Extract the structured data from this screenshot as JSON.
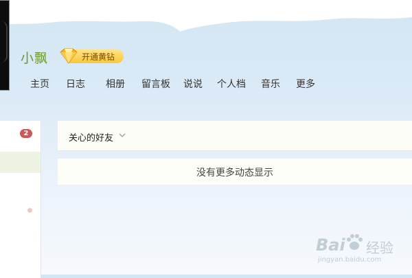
{
  "profile": {
    "username": "小飘",
    "vip_label": "开通黄钻",
    "icon": "diamond-icon"
  },
  "nav": {
    "items": [
      {
        "label": "主页"
      },
      {
        "label": "日志"
      },
      {
        "label": "相册"
      },
      {
        "label": "留言板"
      },
      {
        "label": "说说"
      },
      {
        "label": "个人档"
      },
      {
        "label": "音乐"
      },
      {
        "label": "更多"
      }
    ]
  },
  "sidebar": {
    "badge_count": "2"
  },
  "feed": {
    "filter_label": "关心的好友",
    "filter_icon": "chevron-down-icon",
    "empty_message": "没有更多动态显示"
  },
  "watermark": {
    "brand_left": "Bai",
    "brand_right": "经验",
    "url": "jingyan.baidu.com"
  },
  "colors": {
    "username": "#6a9a2c",
    "vip_gold": "#fbc737",
    "badge_red": "#cc5858"
  }
}
